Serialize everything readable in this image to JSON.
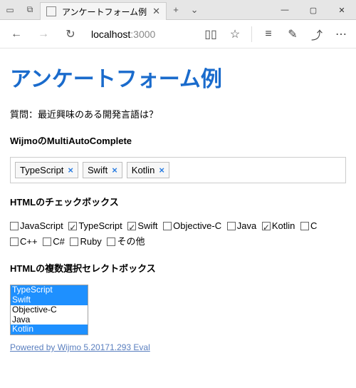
{
  "window": {
    "tab_title": "アンケートフォーム例",
    "new_tab_glyph": "+",
    "tab_dropdown_glyph": "⌄",
    "min_glyph": "—",
    "max_glyph": "▢",
    "close_glyph": "✕"
  },
  "toolbar": {
    "back_glyph": "←",
    "forward_glyph": "→",
    "reload_glyph": "↻",
    "url_host": "localhost",
    "url_port": ":3000",
    "reader_glyph": "▯▯",
    "star_glyph": "☆",
    "hub_glyph": "≡",
    "notes_glyph": "✎",
    "share_glyph": "⤴",
    "more_glyph": "⋯"
  },
  "page": {
    "title": "アンケートフォーム例",
    "question": "質問：最近興味のある開発言語は？",
    "section_multi_auto": "WijmoのMultiAutoComplete",
    "tokens": [
      {
        "label": "TypeScript"
      },
      {
        "label": "Swift"
      },
      {
        "label": "Kotlin"
      }
    ],
    "token_remove_glyph": "×",
    "section_checkbox": "HTMLのチェックボックス",
    "check_items": [
      {
        "label": "JavaScript",
        "checked": false
      },
      {
        "label": "TypeScript",
        "checked": true
      },
      {
        "label": "Swift",
        "checked": true
      },
      {
        "label": "Objective-C",
        "checked": false
      },
      {
        "label": "Java",
        "checked": false
      },
      {
        "label": "Kotlin",
        "checked": true
      },
      {
        "label": "C",
        "checked": false
      },
      {
        "label": "C++",
        "checked": false
      },
      {
        "label": "C#",
        "checked": false
      },
      {
        "label": "Ruby",
        "checked": false
      },
      {
        "label": "その他",
        "checked": false
      }
    ],
    "section_select": "HTMLの複数選択セレクトボックス",
    "select_options": [
      {
        "label": "TypeScript",
        "selected": true
      },
      {
        "label": "Swift",
        "selected": true
      },
      {
        "label": "Objective-C",
        "selected": false
      },
      {
        "label": "Java",
        "selected": false
      },
      {
        "label": "Kotlin",
        "selected": true
      }
    ],
    "footer_link": "Powered by Wijmo 5.20171.293 Eval"
  }
}
